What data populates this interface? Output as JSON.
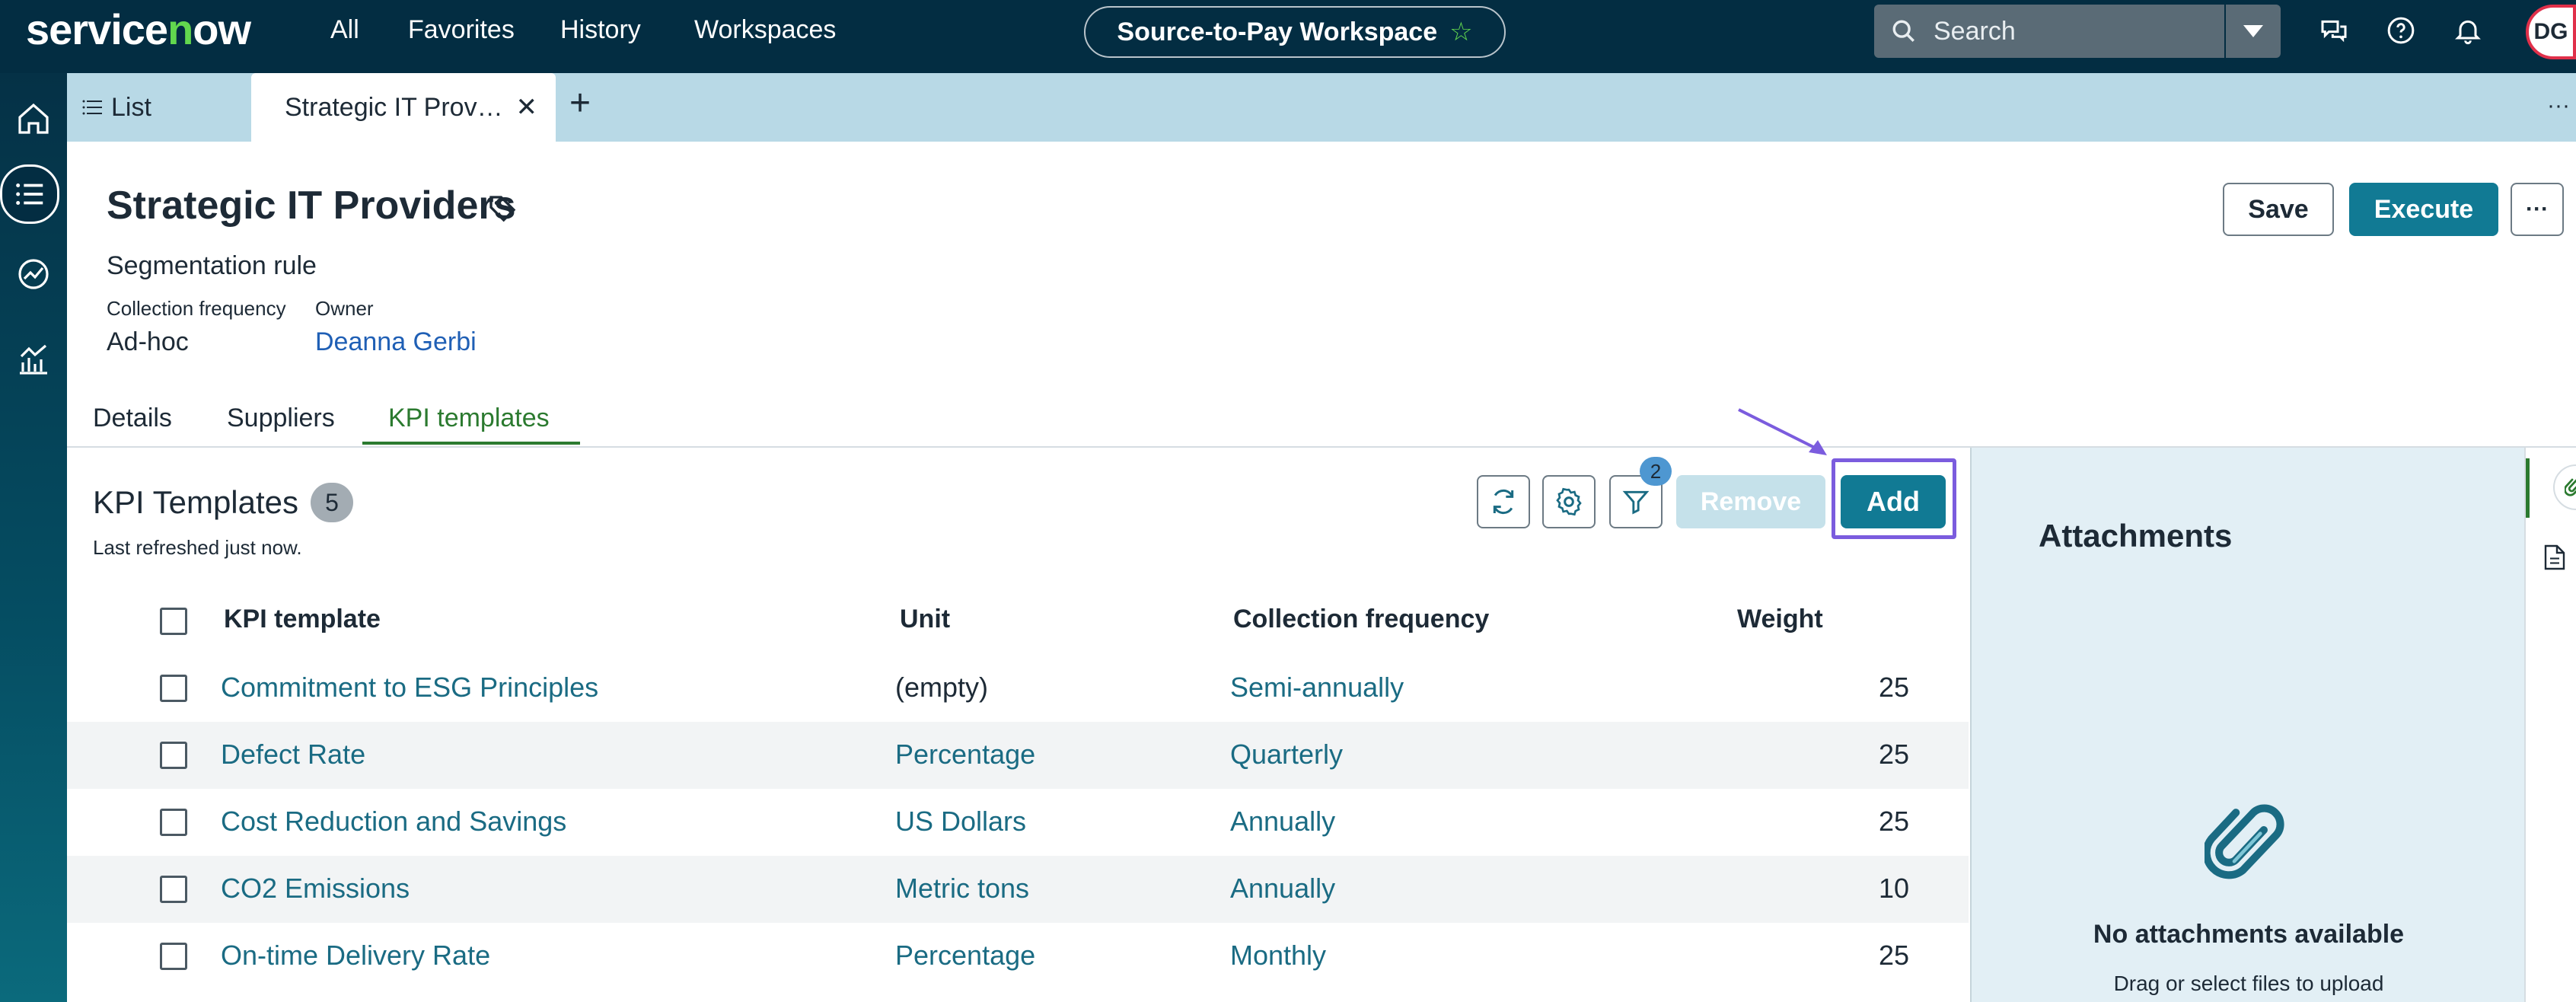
{
  "topbar": {
    "logo": "servicenow",
    "nav": [
      "All",
      "Favorites",
      "History",
      "Workspaces"
    ],
    "workspace_name": "Source-to-Pay Workspace",
    "search_placeholder": "Search",
    "avatar_initials": "DG"
  },
  "tabs": {
    "list_label": "List",
    "active_tab": "Strategic IT Prov…"
  },
  "record": {
    "title": "Strategic IT Providers",
    "subtitle": "Segmentation rule",
    "fields": [
      {
        "label": "Collection frequency",
        "value": "Ad-hoc"
      },
      {
        "label": "Owner",
        "value": "Deanna Gerbi"
      }
    ],
    "actions": {
      "save": "Save",
      "execute": "Execute",
      "more": "···"
    }
  },
  "subtabs": [
    "Details",
    "Suppliers",
    "KPI templates"
  ],
  "kpi_list": {
    "title": "KPI Templates",
    "count": "5",
    "refreshed": "Last refreshed just now.",
    "filter_count": "2",
    "remove_label": "Remove",
    "add_label": "Add",
    "columns": [
      "KPI template",
      "Unit",
      "Collection frequency",
      "Weight"
    ],
    "rows": [
      {
        "template": "Commitment to ESG Principles",
        "unit": "(empty)",
        "frequency": "Semi-annually",
        "weight": "25"
      },
      {
        "template": "Defect Rate",
        "unit": "Percentage",
        "frequency": "Quarterly",
        "weight": "25"
      },
      {
        "template": "Cost Reduction and Savings",
        "unit": "US Dollars",
        "frequency": "Annually",
        "weight": "25"
      },
      {
        "template": "CO2 Emissions",
        "unit": "Metric tons",
        "frequency": "Annually",
        "weight": "10"
      },
      {
        "template": "On-time Delivery Rate",
        "unit": "Percentage",
        "frequency": "Monthly",
        "weight": "25"
      }
    ]
  },
  "attachments": {
    "title": "Attachments",
    "empty": "No attachments available",
    "hint": "Drag or select files to upload"
  },
  "colors": {
    "topbar": "#032d42",
    "accent": "#117a94",
    "active_tab": "#2b7a2f",
    "highlight": "#7b5cde"
  }
}
